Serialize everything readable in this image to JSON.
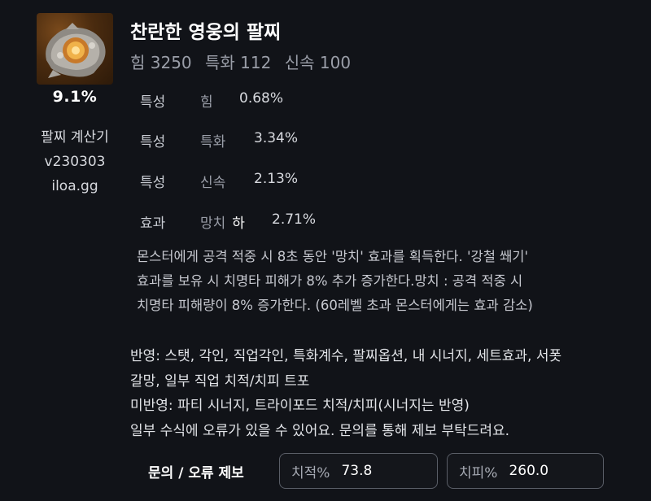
{
  "item": {
    "icon": "bracelet-icon",
    "quality": "9.1%",
    "name": "찬란한 영웅의 팔찌",
    "base_stats": [
      "힘 3250",
      "특화 112",
      "신속 100"
    ]
  },
  "brand": {
    "name": "팔찌 계산기",
    "version": "v230303",
    "site": "iloa.gg"
  },
  "options": [
    {
      "type": "특성",
      "name": "힘",
      "grade": "",
      "value": "0.68%"
    },
    {
      "type": "특성",
      "name": "특화",
      "grade": "",
      "value": "3.34%"
    },
    {
      "type": "특성",
      "name": "신속",
      "grade": "",
      "value": "2.13%"
    },
    {
      "type": "효과",
      "name": "망치",
      "grade": "하",
      "value": "2.71%"
    }
  ],
  "effect_description": [
    "몬스터에게 공격 적중 시 8초 동안 '망치' 효과를 획득한다. '강철 쐐기'",
    "효과를 보유 시 치명타 피해가 8% 추가 증가한다.망치 : 공격 적중 시",
    "치명타 피해량이 8% 증가한다. (60레벨 초과 몬스터에게는 효과 감소)"
  ],
  "notes": [
    "반영: 스탯, 각인, 직업각인, 특화계수, 팔찌옵션, 내 시너지, 세트효과, 서폿",
    "갈망, 일부 직업 치적/치피 트포",
    "미반영: 파티 시너지, 트라이포드 치적/치피(시너지는 반영)",
    "일부 수식에 오류가 있을 수 있어요. 문의를 통해 제보 부탁드려요."
  ],
  "footer": {
    "report_label": "문의 / 오류 제보",
    "crit_rate_label": "치적%",
    "crit_rate_value": "73.8",
    "crit_dmg_label": "치피%",
    "crit_dmg_value": "260.0"
  }
}
